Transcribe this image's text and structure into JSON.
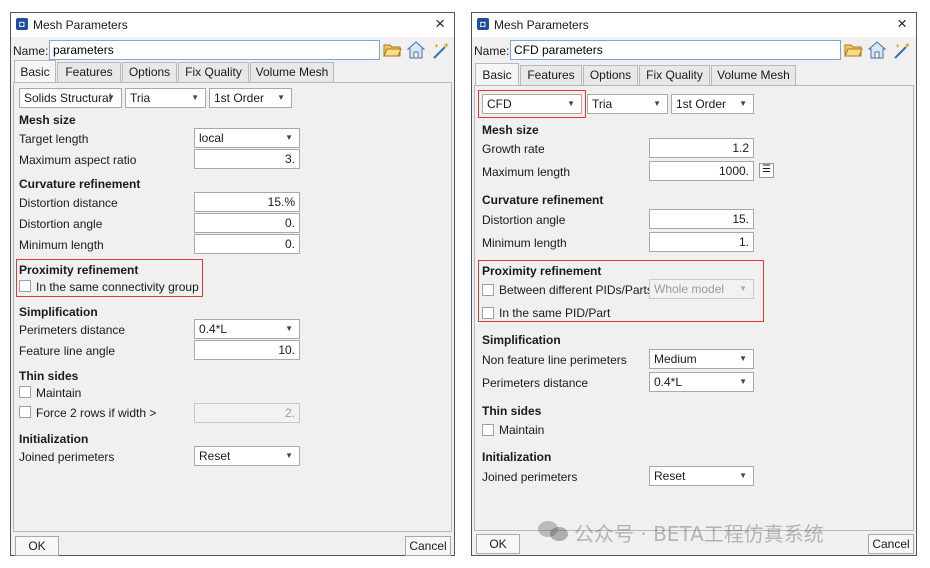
{
  "left": {
    "title": "Mesh Parameters",
    "close_glyph": "×",
    "name_label": "Name:",
    "name_value": "parameters",
    "icons": [
      "open-folder-icon",
      "save-icon",
      "magic-wand-icon"
    ],
    "tabs": [
      "Basic",
      "Features",
      "Options",
      "Fix Quality",
      "Volume Mesh"
    ],
    "active_tab": "Basic",
    "type_combos": [
      "Solids Structural",
      "Tria",
      "1st Order"
    ],
    "mesh_size": {
      "heading": "Mesh size",
      "target_length_label": "Target length",
      "target_length_value": "local",
      "max_aspect_label": "Maximum aspect ratio",
      "max_aspect_value": "3."
    },
    "curvature": {
      "heading": "Curvature refinement",
      "distortion_distance_label": "Distortion distance",
      "distortion_distance_value": "15.%",
      "distortion_angle_label": "Distortion angle",
      "distortion_angle_value": "0.",
      "min_length_label": "Minimum length",
      "min_length_value": "0."
    },
    "proximity": {
      "heading": "Proximity refinement",
      "same_group_label": "In the same connectivity group"
    },
    "simplification": {
      "heading": "Simplification",
      "perimeters_label": "Perimeters distance",
      "perimeters_value": "0.4*L",
      "feature_angle_label": "Feature line angle",
      "feature_angle_value": "10."
    },
    "thin_sides": {
      "heading": "Thin sides",
      "maintain_label": "Maintain",
      "force_rows_label": "Force 2 rows if width >",
      "force_rows_value": "2."
    },
    "initialization": {
      "heading": "Initialization",
      "joined_label": "Joined perimeters",
      "joined_value": "Reset"
    },
    "ok_label": "OK",
    "cancel_label": "Cancel"
  },
  "right": {
    "title": "Mesh Parameters",
    "close_glyph": "×",
    "name_label": "Name:",
    "name_value": "CFD parameters",
    "icons": [
      "open-folder-icon",
      "save-icon",
      "magic-wand-icon"
    ],
    "tabs": [
      "Basic",
      "Features",
      "Options",
      "Fix Quality",
      "Volume Mesh"
    ],
    "active_tab": "Basic",
    "type_combos": [
      "CFD",
      "Tria",
      "1st Order"
    ],
    "mesh_size": {
      "heading": "Mesh size",
      "growth_label": "Growth rate",
      "growth_value": "1.2",
      "max_length_label": "Maximum length",
      "max_length_value": "1000.",
      "menu_glyph": "☰"
    },
    "curvature": {
      "heading": "Curvature refinement",
      "distortion_angle_label": "Distortion angle",
      "distortion_angle_value": "15.",
      "min_length_label": "Minimum length",
      "min_length_value": "1."
    },
    "proximity": {
      "heading": "Proximity refinement",
      "between_label": "Between different PIDs/Parts",
      "between_value": "Whole model",
      "same_pid_label": "In the same PID/Part"
    },
    "simplification": {
      "heading": "Simplification",
      "non_feature_label": "Non feature line perimeters",
      "non_feature_value": "Medium",
      "perimeters_label": "Perimeters distance",
      "perimeters_value": "0.4*L"
    },
    "thin_sides": {
      "heading": "Thin sides",
      "maintain_label": "Maintain"
    },
    "initialization": {
      "heading": "Initialization",
      "joined_label": "Joined perimeters",
      "joined_value": "Reset"
    },
    "ok_label": "OK",
    "cancel_label": "Cancel"
  },
  "watermark": "公众号 · BETA工程仿真系统",
  "colors": {
    "highlight": "#e33939",
    "title_icon": "#1f4e9a",
    "focus_border": "#7aa7d8"
  }
}
